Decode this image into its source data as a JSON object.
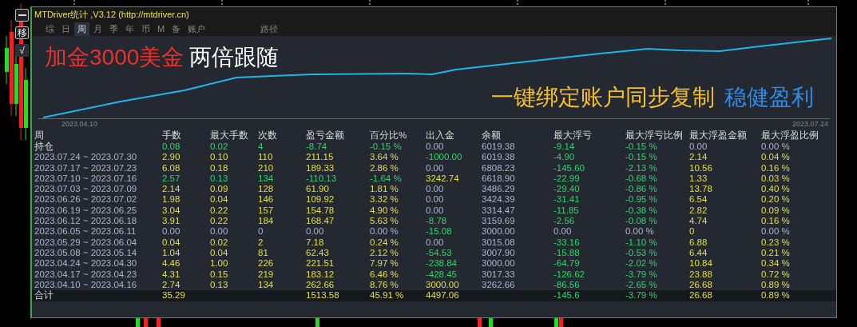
{
  "side_buttons": [
    "移",
    "√"
  ],
  "window": {
    "title": "MTDriver统计 ,V3.12 (http://mtdriver.cn)"
  },
  "tabs": [
    {
      "label": "综",
      "selected": false
    },
    {
      "label": "日",
      "selected": false
    },
    {
      "label": "周",
      "selected": true
    },
    {
      "label": "月",
      "selected": false
    },
    {
      "label": "季",
      "selected": false
    },
    {
      "label": "年",
      "selected": false
    },
    {
      "label": "币",
      "selected": false
    },
    {
      "label": "M",
      "selected": false
    },
    {
      "label": "备",
      "selected": false
    },
    {
      "label": "账户",
      "selected": false
    }
  ],
  "path_button": "路径",
  "banner": {
    "headline_red": "加金3000美金",
    "headline_white": "两倍跟随",
    "slogan_yellow": "一键绑定账户同步复制",
    "slogan_blue": "稳健盈利"
  },
  "chart": {
    "start_label": "2023.04.10",
    "end_label": "2023.07.24"
  },
  "table": {
    "columns": [
      "周",
      "手数",
      "最大手数",
      "次数",
      "盈亏金额",
      "百分比%",
      "出入金",
      "余额",
      "最大浮亏",
      "最大浮亏比例",
      "最大浮盈金额",
      "最大浮盈比例"
    ],
    "rows": [
      {
        "cells": [
          {
            "t": "持仓",
            "kind": "label"
          },
          {
            "t": "0.08",
            "kind": "loss"
          },
          {
            "t": "0.02",
            "kind": "loss"
          },
          {
            "t": "4",
            "kind": "loss"
          },
          {
            "t": "-8.74",
            "kind": "loss"
          },
          {
            "t": "-0.15 %",
            "kind": "loss"
          },
          {
            "t": "0.00",
            "kind": "flat"
          },
          {
            "t": "6019.38",
            "kind": "flat"
          },
          {
            "t": "-9.14",
            "kind": "loss"
          },
          {
            "t": "-0.15 %",
            "kind": "loss"
          },
          {
            "t": "0.00",
            "kind": "flat"
          },
          {
            "t": "0.00 %",
            "kind": "flat"
          }
        ]
      },
      {
        "cells": [
          {
            "t": "2023.07.24 ~ 2023.07.30",
            "kind": "date"
          },
          {
            "t": "2.90",
            "kind": "gain"
          },
          {
            "t": "0.10",
            "kind": "gain"
          },
          {
            "t": "110",
            "kind": "gain"
          },
          {
            "t": "211.15",
            "kind": "gain"
          },
          {
            "t": "3.64 %",
            "kind": "gain"
          },
          {
            "t": "-1000.00",
            "kind": "loss"
          },
          {
            "t": "6019.38",
            "kind": "flat"
          },
          {
            "t": "-4.90",
            "kind": "loss"
          },
          {
            "t": "-0.15 %",
            "kind": "loss"
          },
          {
            "t": "2.14",
            "kind": "gain"
          },
          {
            "t": "0.04 %",
            "kind": "gain"
          }
        ]
      },
      {
        "cells": [
          {
            "t": "2023.07.17 ~ 2023.07.23",
            "kind": "date"
          },
          {
            "t": "6.08",
            "kind": "gain"
          },
          {
            "t": "0.18",
            "kind": "gain"
          },
          {
            "t": "210",
            "kind": "gain"
          },
          {
            "t": "189.33",
            "kind": "gain"
          },
          {
            "t": "2.86 %",
            "kind": "gain"
          },
          {
            "t": "0.00",
            "kind": "flat"
          },
          {
            "t": "6808.23",
            "kind": "flat"
          },
          {
            "t": "-145.60",
            "kind": "loss"
          },
          {
            "t": "-2.13 %",
            "kind": "loss"
          },
          {
            "t": "10.56",
            "kind": "gain"
          },
          {
            "t": "0.16 %",
            "kind": "gain"
          }
        ]
      },
      {
        "cells": [
          {
            "t": "2023.07.10 ~ 2023.07.16",
            "kind": "date"
          },
          {
            "t": "2.57",
            "kind": "loss"
          },
          {
            "t": "0.13",
            "kind": "loss"
          },
          {
            "t": "134",
            "kind": "loss"
          },
          {
            "t": "-110.13",
            "kind": "loss"
          },
          {
            "t": "-1.64 %",
            "kind": "loss"
          },
          {
            "t": "3242.74",
            "kind": "gain"
          },
          {
            "t": "6618.90",
            "kind": "flat"
          },
          {
            "t": "-22.99",
            "kind": "loss"
          },
          {
            "t": "-0.68 %",
            "kind": "loss"
          },
          {
            "t": "1.33",
            "kind": "gain"
          },
          {
            "t": "0.03 %",
            "kind": "gain"
          }
        ]
      },
      {
        "cells": [
          {
            "t": "2023.07.03 ~ 2023.07.09",
            "kind": "date"
          },
          {
            "t": "2.14",
            "kind": "gain"
          },
          {
            "t": "0.09",
            "kind": "gain"
          },
          {
            "t": "128",
            "kind": "gain"
          },
          {
            "t": "61.90",
            "kind": "gain"
          },
          {
            "t": "1.81 %",
            "kind": "gain"
          },
          {
            "t": "0.00",
            "kind": "flat"
          },
          {
            "t": "3486.29",
            "kind": "flat"
          },
          {
            "t": "-29.40",
            "kind": "loss"
          },
          {
            "t": "-0.86 %",
            "kind": "loss"
          },
          {
            "t": "13.78",
            "kind": "gain"
          },
          {
            "t": "0.40 %",
            "kind": "gain"
          }
        ]
      },
      {
        "cells": [
          {
            "t": "2023.06.26 ~ 2023.07.02",
            "kind": "date"
          },
          {
            "t": "1.98",
            "kind": "gain"
          },
          {
            "t": "0.04",
            "kind": "gain"
          },
          {
            "t": "146",
            "kind": "gain"
          },
          {
            "t": "109.92",
            "kind": "gain"
          },
          {
            "t": "3.32 %",
            "kind": "gain"
          },
          {
            "t": "0.00",
            "kind": "flat"
          },
          {
            "t": "3424.39",
            "kind": "flat"
          },
          {
            "t": "-31.41",
            "kind": "loss"
          },
          {
            "t": "-0.95 %",
            "kind": "loss"
          },
          {
            "t": "6.54",
            "kind": "gain"
          },
          {
            "t": "0.20 %",
            "kind": "gain"
          }
        ]
      },
      {
        "cells": [
          {
            "t": "2023.06.19 ~ 2023.06.25",
            "kind": "date"
          },
          {
            "t": "3.04",
            "kind": "gain"
          },
          {
            "t": "0.22",
            "kind": "gain"
          },
          {
            "t": "157",
            "kind": "gain"
          },
          {
            "t": "154.78",
            "kind": "gain"
          },
          {
            "t": "4.90 %",
            "kind": "gain"
          },
          {
            "t": "0.00",
            "kind": "flat"
          },
          {
            "t": "3314.47",
            "kind": "flat"
          },
          {
            "t": "-11.85",
            "kind": "loss"
          },
          {
            "t": "-0.38 %",
            "kind": "loss"
          },
          {
            "t": "2.82",
            "kind": "gain"
          },
          {
            "t": "0.09 %",
            "kind": "gain"
          }
        ]
      },
      {
        "cells": [
          {
            "t": "2023.06.12 ~ 2023.06.18",
            "kind": "date"
          },
          {
            "t": "3.91",
            "kind": "gain"
          },
          {
            "t": "0.22",
            "kind": "gain"
          },
          {
            "t": "184",
            "kind": "gain"
          },
          {
            "t": "168.47",
            "kind": "gain"
          },
          {
            "t": "5.63 %",
            "kind": "gain"
          },
          {
            "t": "-8.78",
            "kind": "loss"
          },
          {
            "t": "3159.69",
            "kind": "flat"
          },
          {
            "t": "-2.56",
            "kind": "loss"
          },
          {
            "t": "-0.08 %",
            "kind": "loss"
          },
          {
            "t": "4.74",
            "kind": "gain"
          },
          {
            "t": "0.16 %",
            "kind": "gain"
          }
        ]
      },
      {
        "cells": [
          {
            "t": "2023.06.05 ~ 2023.06.11",
            "kind": "date"
          },
          {
            "t": "0.00",
            "kind": "flat"
          },
          {
            "t": "0.00",
            "kind": "flat"
          },
          {
            "t": "0",
            "kind": "flat"
          },
          {
            "t": "0.00",
            "kind": "flat"
          },
          {
            "t": "0.00 %",
            "kind": "flat"
          },
          {
            "t": "-15.08",
            "kind": "loss"
          },
          {
            "t": "3000.00",
            "kind": "flat"
          },
          {
            "t": "0.00",
            "kind": "flat"
          },
          {
            "t": "0.00 %",
            "kind": "flat"
          },
          {
            "t": "0",
            "kind": "gain"
          },
          {
            "t": "0.00 %",
            "kind": "flat"
          }
        ]
      },
      {
        "cells": [
          {
            "t": "2023.05.29 ~ 2023.06.04",
            "kind": "date"
          },
          {
            "t": "0.04",
            "kind": "gain"
          },
          {
            "t": "0.02",
            "kind": "gain"
          },
          {
            "t": "2",
            "kind": "gain"
          },
          {
            "t": "7.18",
            "kind": "gain"
          },
          {
            "t": "0.24 %",
            "kind": "gain"
          },
          {
            "t": "0.00",
            "kind": "flat"
          },
          {
            "t": "3015.08",
            "kind": "flat"
          },
          {
            "t": "-33.16",
            "kind": "loss"
          },
          {
            "t": "-1.10 %",
            "kind": "loss"
          },
          {
            "t": "6.88",
            "kind": "gain"
          },
          {
            "t": "0.23 %",
            "kind": "gain"
          }
        ]
      },
      {
        "cells": [
          {
            "t": "2023.05.08 ~ 2023.05.14",
            "kind": "date"
          },
          {
            "t": "1.04",
            "kind": "gain"
          },
          {
            "t": "0.04",
            "kind": "gain"
          },
          {
            "t": "81",
            "kind": "gain"
          },
          {
            "t": "62.43",
            "kind": "gain"
          },
          {
            "t": "2.12 %",
            "kind": "gain"
          },
          {
            "t": "-54.53",
            "kind": "loss"
          },
          {
            "t": "3007.90",
            "kind": "flat"
          },
          {
            "t": "-15.88",
            "kind": "loss"
          },
          {
            "t": "-0.53 %",
            "kind": "loss"
          },
          {
            "t": "6.44",
            "kind": "gain"
          },
          {
            "t": "0.21 %",
            "kind": "gain"
          }
        ]
      },
      {
        "cells": [
          {
            "t": "2023.04.24 ~ 2023.04.30",
            "kind": "date"
          },
          {
            "t": "4.46",
            "kind": "gain"
          },
          {
            "t": "1.00",
            "kind": "gain"
          },
          {
            "t": "226",
            "kind": "gain"
          },
          {
            "t": "221.51",
            "kind": "gain"
          },
          {
            "t": "7.97 %",
            "kind": "gain"
          },
          {
            "t": "-238.84",
            "kind": "loss"
          },
          {
            "t": "3000.00",
            "kind": "flat"
          },
          {
            "t": "-64.79",
            "kind": "loss"
          },
          {
            "t": "-2.02 %",
            "kind": "loss"
          },
          {
            "t": "10.84",
            "kind": "gain"
          },
          {
            "t": "0.34 %",
            "kind": "gain"
          }
        ]
      },
      {
        "cells": [
          {
            "t": "2023.04.17 ~ 2023.04.23",
            "kind": "date"
          },
          {
            "t": "4.31",
            "kind": "gain"
          },
          {
            "t": "0.15",
            "kind": "gain"
          },
          {
            "t": "219",
            "kind": "gain"
          },
          {
            "t": "183.12",
            "kind": "gain"
          },
          {
            "t": "6.46 %",
            "kind": "gain"
          },
          {
            "t": "-428.45",
            "kind": "loss"
          },
          {
            "t": "3017.33",
            "kind": "flat"
          },
          {
            "t": "-126.62",
            "kind": "loss"
          },
          {
            "t": "-3.79 %",
            "kind": "loss"
          },
          {
            "t": "23.88",
            "kind": "gain"
          },
          {
            "t": "0.72 %",
            "kind": "gain"
          }
        ]
      },
      {
        "cells": [
          {
            "t": "2023.04.10 ~ 2023.04.16",
            "kind": "date"
          },
          {
            "t": "2.74",
            "kind": "gain"
          },
          {
            "t": "0.13",
            "kind": "gain"
          },
          {
            "t": "134",
            "kind": "gain"
          },
          {
            "t": "262.66",
            "kind": "gain"
          },
          {
            "t": "8.76 %",
            "kind": "gain"
          },
          {
            "t": "3000.00",
            "kind": "gain"
          },
          {
            "t": "3262.66",
            "kind": "flat"
          },
          {
            "t": "-86.56",
            "kind": "loss"
          },
          {
            "t": "-2.65 %",
            "kind": "loss"
          },
          {
            "t": "26.68",
            "kind": "gain"
          },
          {
            "t": "0.89 %",
            "kind": "gain"
          }
        ]
      }
    ],
    "total": {
      "cells": [
        {
          "t": "合计",
          "kind": "label"
        },
        {
          "t": "35.29",
          "kind": "gain"
        },
        null,
        null,
        {
          "t": "1513.58",
          "kind": "gain"
        },
        {
          "t": "45.91 %",
          "kind": "gain"
        },
        {
          "t": "4497.06",
          "kind": "gain"
        },
        null,
        {
          "t": "-145.6",
          "kind": "loss"
        },
        {
          "t": "-3.79 %",
          "kind": "loss"
        },
        {
          "t": "26.68",
          "kind": "gain"
        },
        {
          "t": "0.89 %",
          "kind": "gain"
        }
      ]
    }
  }
}
